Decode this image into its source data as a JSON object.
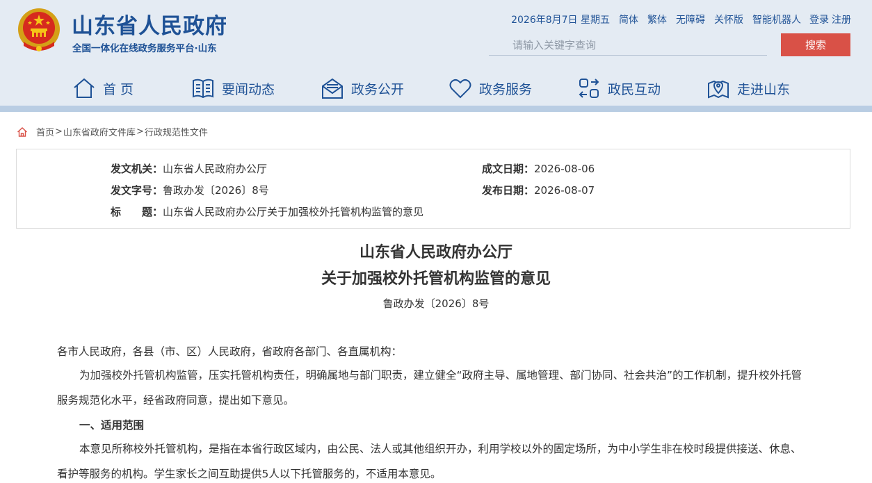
{
  "header": {
    "title": "山东省人民政府",
    "subtitle": "全国一体化在线政务服务平台·山东",
    "top_links": {
      "date": "2026年8月7日 星期五",
      "simplified": "简体",
      "traditional": "繁体",
      "accessibility": "无障碍",
      "care_mode": "关怀版",
      "robot": "智能机器人",
      "login": "登录",
      "register": "注册"
    },
    "search": {
      "placeholder": "请输入关键字查询",
      "button": "搜索"
    },
    "nav": [
      {
        "label": "首 页",
        "icon": "home-icon"
      },
      {
        "label": "要闻动态",
        "icon": "news-book-icon"
      },
      {
        "label": "政务公开",
        "icon": "mail-envelope-icon"
      },
      {
        "label": "政务服务",
        "icon": "heart-icon"
      },
      {
        "label": "政民互动",
        "icon": "interaction-arrows-icon"
      },
      {
        "label": "走进山东",
        "icon": "map-pin-icon"
      }
    ]
  },
  "breadcrumb": {
    "items": [
      "首页",
      "山东省政府文件库",
      "行政规范性文件"
    ],
    "separator": ">"
  },
  "meta": {
    "issuer_label": "发文机关：",
    "issuer": "山东省人民政府办公厅",
    "doc_number_label": "发文字号：",
    "doc_number": "鲁政办发〔2026〕8号",
    "title_label": "标　　题：",
    "title": "山东省人民政府办公厅关于加强校外托管机构监管的意见",
    "created_label": "成文日期：",
    "created": "2026-08-06",
    "published_label": "发布日期：",
    "published": "2026-08-07"
  },
  "article": {
    "title_line1": "山东省人民政府办公厅",
    "title_line2": "关于加强校外托管机构监管的意见",
    "doc_no": "鲁政办发〔2026〕8号",
    "salutation": "各市人民政府，各县（市、区）人民政府，省政府各部门、各直属机构：",
    "intro": "为加强校外托管机构监管，压实托管机构责任，明确属地与部门职责，建立健全“政府主导、属地管理、部门协同、社会共治”的工作机制，提升校外托管服务规范化水平，经省政府同意，提出如下意见。",
    "section1_title": "一、适用范围",
    "section1_body": "本意见所称校外托管机构，是指在本省行政区域内，由公民、法人或其他组织开办，利用学校以外的固定场所，为中小学生非在校时段提供接送、休息、看护等服务的机构。学生家长之间互助提供5人以下托管服务的，不适用本意见。"
  },
  "colors": {
    "brand_blue": "#1f5296",
    "header_bg": "#e4ebf3",
    "search_red": "#d95147"
  }
}
